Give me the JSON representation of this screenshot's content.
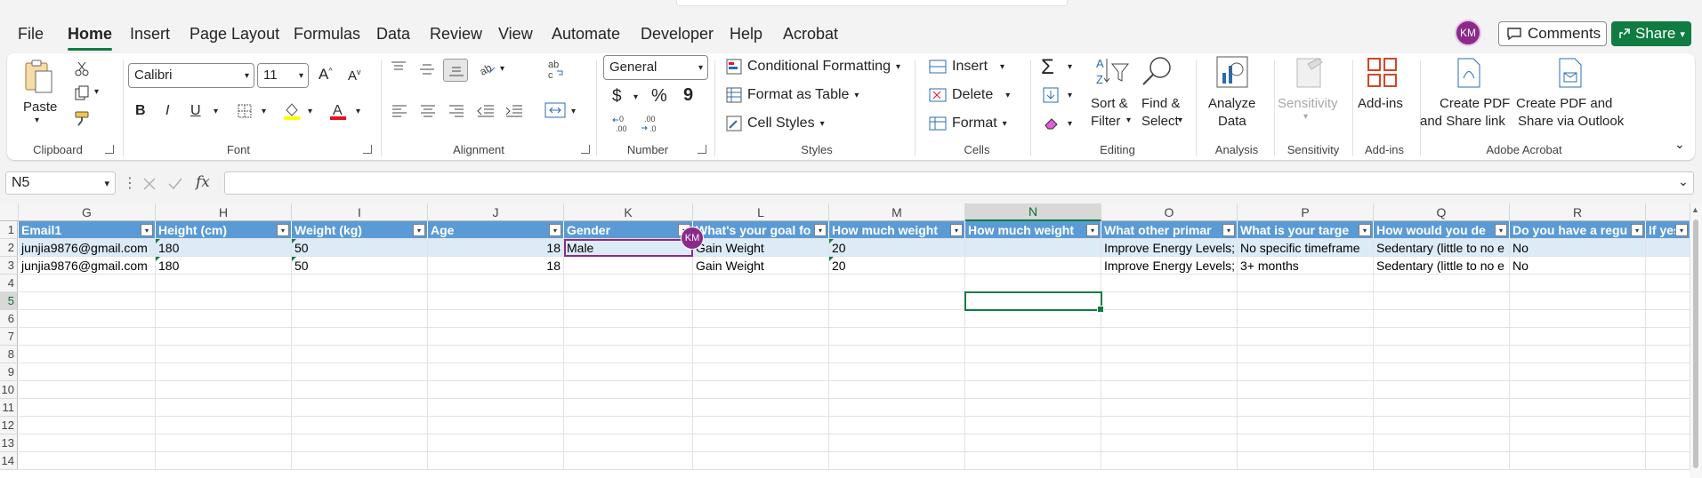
{
  "menu": {
    "tabs": [
      "File",
      "Home",
      "Insert",
      "Page Layout",
      "Formulas",
      "Data",
      "Review",
      "View",
      "Automate",
      "Developer",
      "Help",
      "Acrobat"
    ],
    "active": "Home",
    "avatar_initials": "KM",
    "comments_label": "Comments",
    "share_label": "Share"
  },
  "ribbon": {
    "clipboard": {
      "paste": "Paste",
      "label": "Clipboard"
    },
    "font": {
      "name": "Calibri",
      "size": "11",
      "label": "Font",
      "bold": "B",
      "italic": "I",
      "underline": "U"
    },
    "alignment": {
      "label": "Alignment"
    },
    "number": {
      "format": "General",
      "label": "Number",
      "currency": "$",
      "percent": "%",
      "comma": "9"
    },
    "styles": {
      "conditional": "Conditional Formatting",
      "table": "Format as Table",
      "cell_styles": "Cell Styles",
      "label": "Styles"
    },
    "cells": {
      "insert": "Insert",
      "delete": "Delete",
      "format": "Format",
      "label": "Cells"
    },
    "editing": {
      "sort1": "Sort &",
      "sort2": "Filter",
      "find1": "Find &",
      "find2": "Select",
      "label": "Editing"
    },
    "analysis": {
      "btn1": "Analyze",
      "btn2": "Data",
      "label": "Analysis"
    },
    "sensitivity": {
      "btn": "Sensitivity",
      "label": "Sensitivity"
    },
    "addins": {
      "btn": "Add-ins",
      "label": "Add-ins"
    },
    "acrobat": {
      "btn1a": "Create PDF",
      "btn1b": "and Share link",
      "btn2a": "Create PDF and",
      "btn2b": "Share via Outlook",
      "label": "Adobe Acrobat"
    }
  },
  "formula_bar": {
    "name_box": "N5",
    "fx": "fx",
    "value": ""
  },
  "sheet": {
    "columns": [
      "G",
      "H",
      "I",
      "J",
      "K",
      "L",
      "M",
      "N",
      "O",
      "P",
      "Q",
      "R",
      ""
    ],
    "selected_column": "N",
    "rows": [
      "1",
      "2",
      "3",
      "4",
      "5",
      "6",
      "7",
      "8",
      "9",
      "10",
      "11",
      "12",
      "13",
      "14"
    ],
    "selected_row": "5",
    "headers": [
      "Email1",
      "Height (cm)",
      "Weight (kg)",
      "Age",
      "Gender",
      "What's your goal fo",
      "How much weight",
      "How much weight",
      "What other primar",
      "What is your targe",
      "How would you de",
      "Do you have a regu",
      "If yes"
    ],
    "row2": [
      "junjia9876@gmail.com",
      "180",
      "50",
      "18",
      "Male",
      "Gain Weight",
      "20",
      "",
      "Improve Energy Levels;",
      "No specific timeframe",
      "Sedentary (little to no e",
      "No",
      ""
    ],
    "row3": [
      "junjia9876@gmail.com",
      "180",
      "50",
      "18",
      "",
      "Gain Weight",
      "20",
      "",
      "Improve Energy Levels;",
      "3+ months",
      "Sedentary (little to no e",
      "No",
      ""
    ],
    "collaborator_initials": "KM"
  }
}
